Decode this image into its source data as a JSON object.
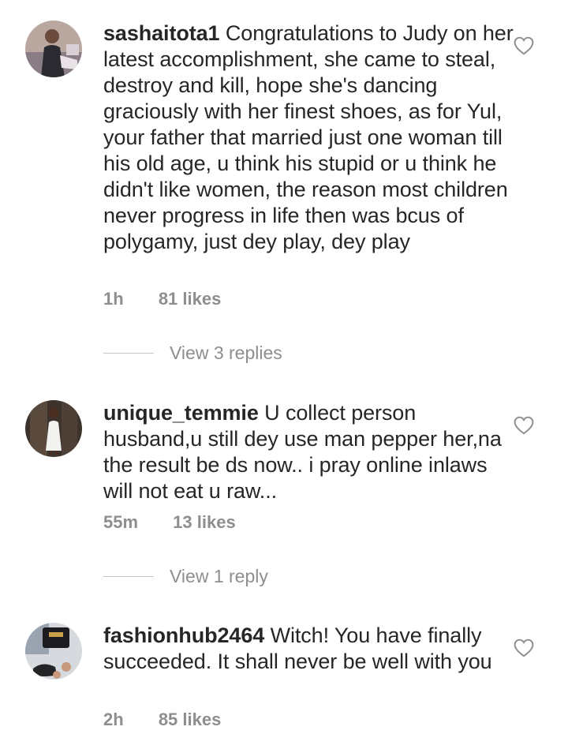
{
  "comments": [
    {
      "username": "sashaitota1",
      "text": "Congratulations to Judy on her latest accomplishment, she came to steal, destroy and kill, hope she's dancing graciously with her finest shoes, as for Yul, your father that married just one woman till his old age, u think his stupid or u think he didn't like women, the reason most children never progress in life then was bcus of polygamy, just dey play, dey play",
      "time": "1h",
      "likes": "81 likes",
      "replies_label": "View 3 replies"
    },
    {
      "username": "unique_temmie",
      "text": "U collect person husband,u still dey use man pepper her,na the result be ds now.. i pray online inlaws will not eat u raw...",
      "time": "55m",
      "likes": "13 likes",
      "replies_label": "View 1 reply"
    },
    {
      "username": "fashionhub2464",
      "text": "Witch! You have finally succeeded. It shall never be well with you",
      "time": "2h",
      "likes": "85 likes"
    }
  ],
  "colors": {
    "text": "#262626",
    "meta": "#8e8e8e",
    "divider": "#c7c7c7"
  },
  "icons": {
    "like": "heart-outline-icon"
  }
}
